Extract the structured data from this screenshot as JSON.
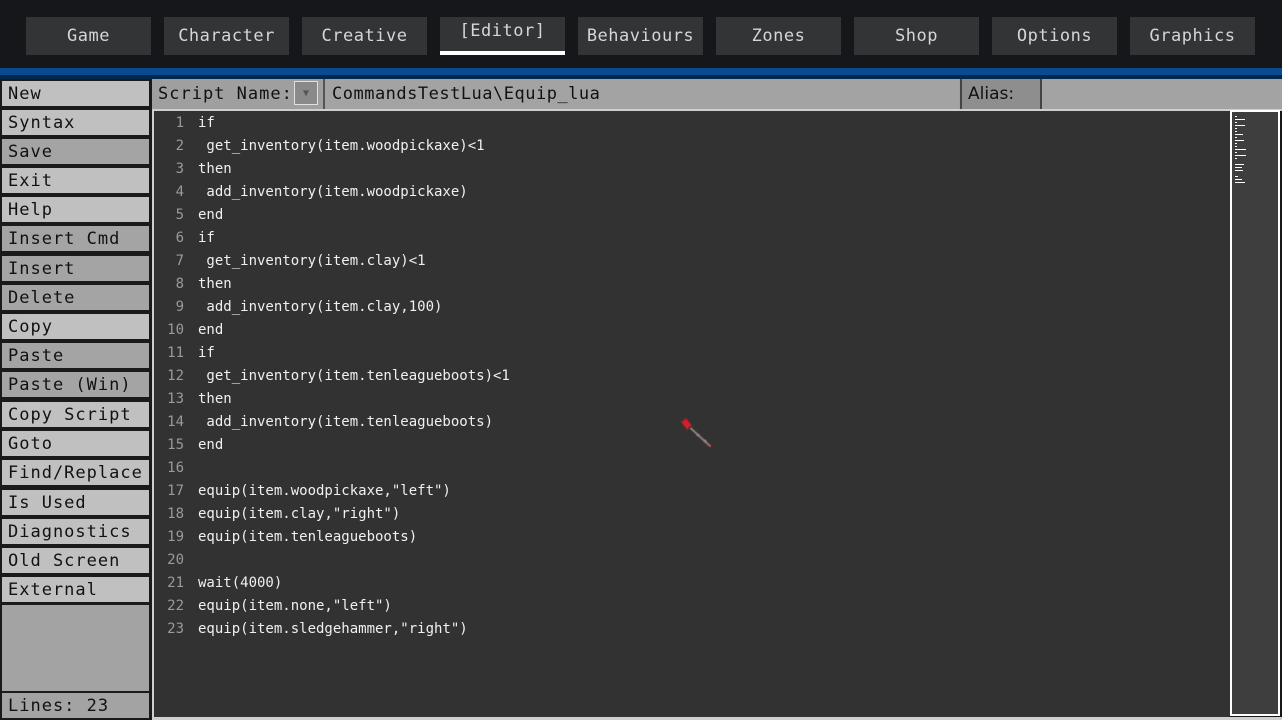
{
  "tabs": [
    {
      "label": "Game",
      "active": false
    },
    {
      "label": "Character",
      "active": false
    },
    {
      "label": "Creative",
      "active": false
    },
    {
      "label": "[Editor]",
      "active": true
    },
    {
      "label": "Behaviours",
      "active": false
    },
    {
      "label": "Zones",
      "active": false
    },
    {
      "label": "Shop",
      "active": false
    },
    {
      "label": "Options",
      "active": false
    },
    {
      "label": "Graphics",
      "active": false
    }
  ],
  "sidebar": {
    "buttons": [
      {
        "label": "New"
      },
      {
        "label": "Syntax"
      },
      {
        "label": "Save"
      },
      {
        "label": "Exit"
      },
      {
        "label": "Help"
      },
      {
        "label": "Insert Cmd"
      },
      {
        "label": "Insert"
      },
      {
        "label": "Delete"
      },
      {
        "label": "Copy"
      },
      {
        "label": "Paste"
      },
      {
        "label": "Paste (Win)"
      },
      {
        "label": "Copy Script"
      },
      {
        "label": "Goto"
      },
      {
        "label": "Find/Replace"
      },
      {
        "label": "Is Used"
      },
      {
        "label": "Diagnostics"
      },
      {
        "label": "Old Screen"
      },
      {
        "label": "External"
      }
    ],
    "lines_label": "Lines: 23"
  },
  "header": {
    "script_name_label": "Script Name:",
    "dropdown_icon": "triangle-down",
    "script_name_value": "CommandsTestLua\\Equip_lua",
    "alias_label": "Alias:",
    "alias_value": ""
  },
  "editor": {
    "lines": [
      {
        "n": "1",
        "text": "if"
      },
      {
        "n": "2",
        "text": " get_inventory(item.woodpickaxe)<1"
      },
      {
        "n": "3",
        "text": "then"
      },
      {
        "n": "4",
        "text": " add_inventory(item.woodpickaxe)"
      },
      {
        "n": "5",
        "text": "end"
      },
      {
        "n": "6",
        "text": "if"
      },
      {
        "n": "7",
        "text": " get_inventory(item.clay)<1"
      },
      {
        "n": "8",
        "text": "then"
      },
      {
        "n": "9",
        "text": " add_inventory(item.clay,100)"
      },
      {
        "n": "10",
        "text": "end"
      },
      {
        "n": "11",
        "text": "if"
      },
      {
        "n": "12",
        "text": " get_inventory(item.tenleagueboots)<1"
      },
      {
        "n": "13",
        "text": "then"
      },
      {
        "n": "14",
        "text": " add_inventory(item.tenleagueboots)"
      },
      {
        "n": "15",
        "text": "end"
      },
      {
        "n": "16",
        "text": ""
      },
      {
        "n": "17",
        "text": "equip(item.woodpickaxe,\"left\")"
      },
      {
        "n": "18",
        "text": "equip(item.clay,\"right\")"
      },
      {
        "n": "19",
        "text": "equip(item.tenleagueboots)"
      },
      {
        "n": "20",
        "text": ""
      },
      {
        "n": "21",
        "text": "wait(4000)"
      },
      {
        "n": "22",
        "text": "equip(item.none,\"left\")"
      },
      {
        "n": "23",
        "text": "equip(item.sledgehammer,\"right\")"
      }
    ]
  },
  "cursor_icon": "sword-cursor-icon"
}
